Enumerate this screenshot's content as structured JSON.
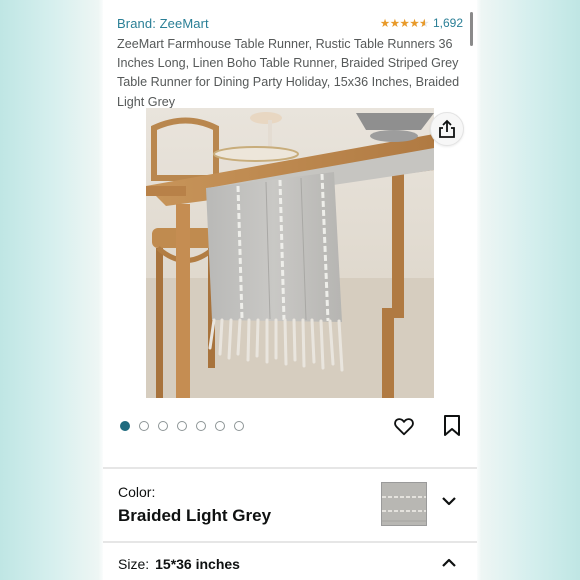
{
  "product": {
    "brand": "Brand: ZeeMart",
    "rating_count": "1,692",
    "rating_value": 4.5,
    "title": "ZeeMart Farmhouse Table Runner, Rustic Table Runners 36 Inches Long, Linen Boho Table Runner, Braided Striped Grey Table Runner for Dining Party Holiday, 15x36 Inches, Braided Light Grey"
  },
  "gallery": {
    "image_count": 7,
    "active_index": 0
  },
  "options": {
    "color_label": "Color:",
    "color_value": "Braided Light Grey",
    "size_label": "Size:",
    "size_value": "15*36 inches"
  },
  "icons": {
    "share": "share-icon",
    "favorite": "heart-icon",
    "save": "bookmark-icon",
    "color_expand": "chevron-down-icon",
    "size_collapse": "chevron-up-icon"
  },
  "colors": {
    "link": "#2a7f96",
    "star": "#e89a2a",
    "active_dot": "#1f6a7e",
    "text": "#0f1111",
    "muted_text": "#565959"
  }
}
